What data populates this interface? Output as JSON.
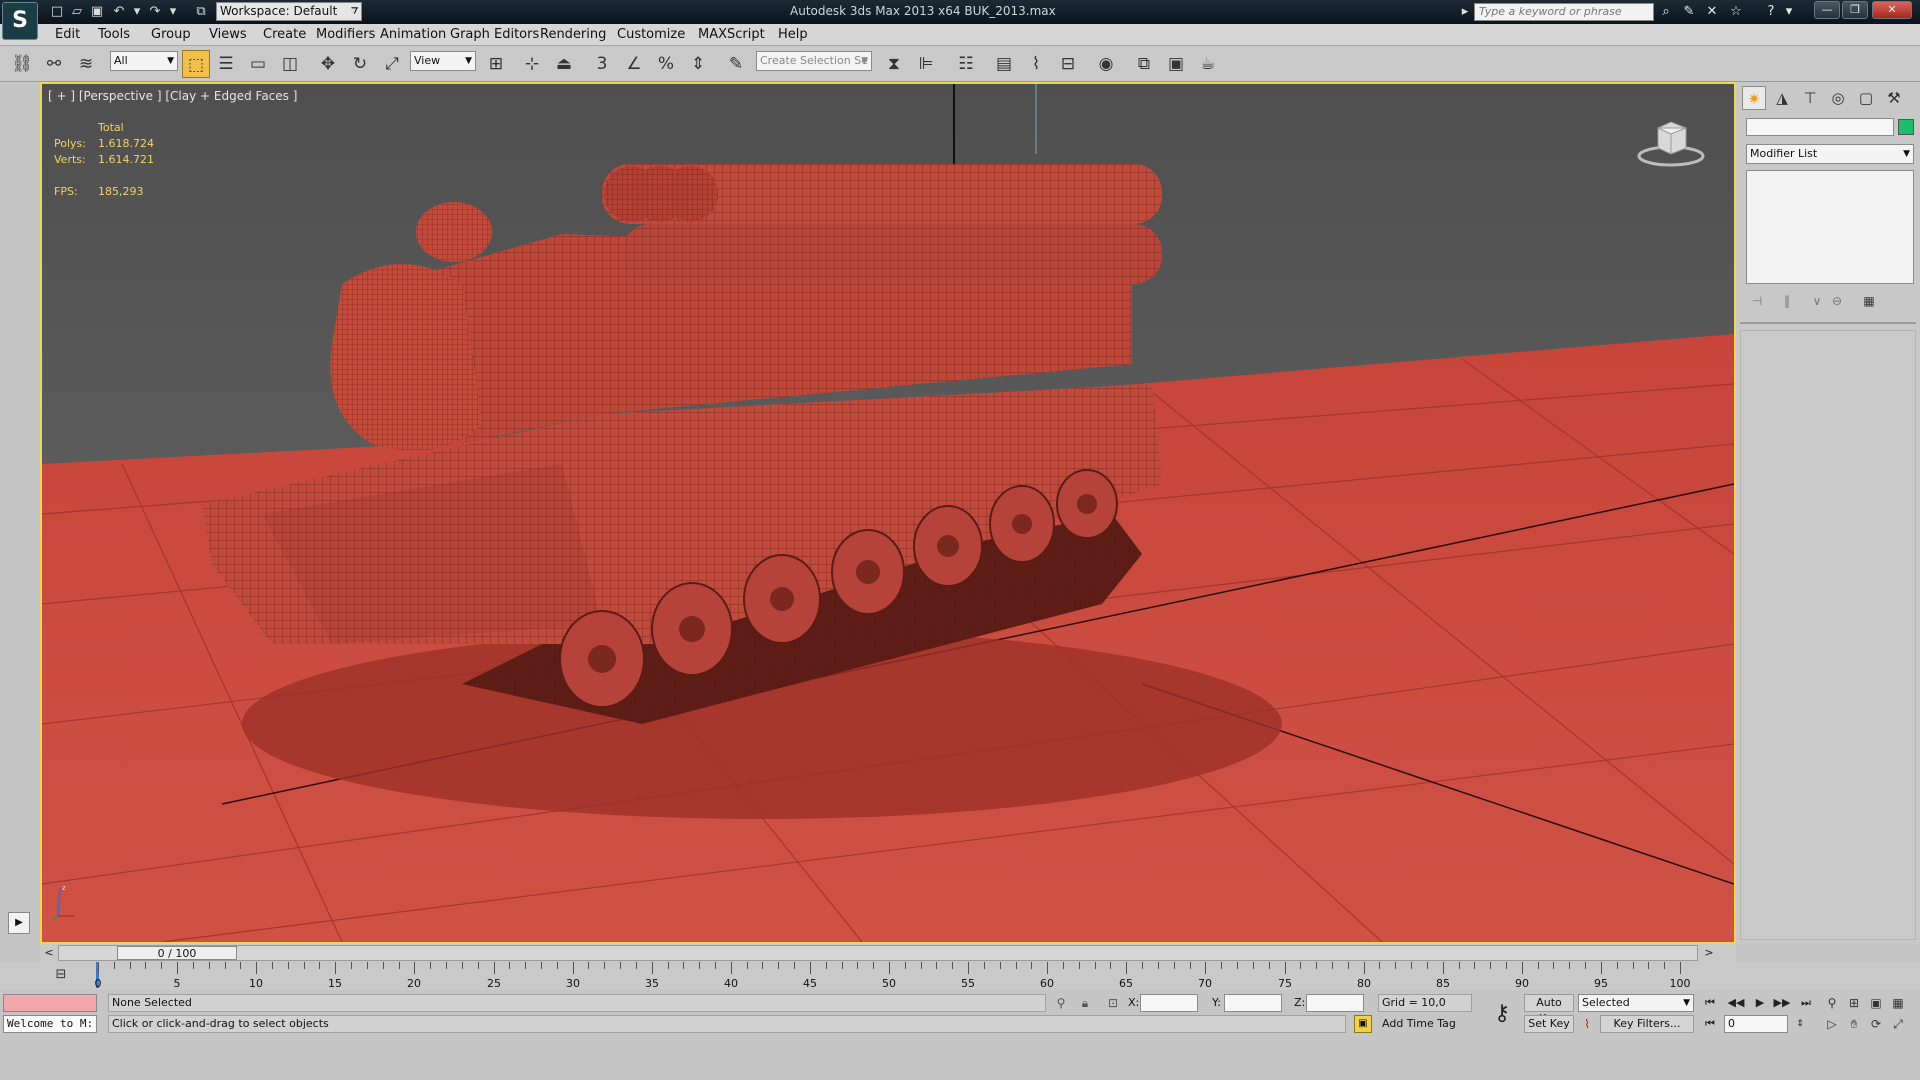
{
  "titlebar": {
    "workspace_label": "Workspace: Default",
    "title": "Autodesk 3ds Max  2013 x64      BUK_2013.max",
    "search_placeholder": "Type a keyword or phrase"
  },
  "menu": [
    "Edit",
    "Tools",
    "Group",
    "Views",
    "Create",
    "Modifiers",
    "Animation",
    "Graph Editors",
    "Rendering",
    "Customize",
    "MAXScript",
    "Help"
  ],
  "toolbar": {
    "selection_filter": "All",
    "ref_coord": "View",
    "named_selection_placeholder": "Create Selection Se"
  },
  "viewport": {
    "label": "[ + ] [Perspective ] [Clay + Edged Faces ]",
    "stats": {
      "header": "Total",
      "polys_label": "Polys:",
      "polys": "1.618.724",
      "verts_label": "Verts:",
      "verts": "1.614.721",
      "fps_label": "FPS:",
      "fps": "185,293"
    },
    "colors": {
      "ground": "#c8483a",
      "model": "#c44a3a",
      "sky": "#5b5b5b",
      "border": "#f1d84a"
    }
  },
  "command_panel": {
    "modifier_list": "Modifier List"
  },
  "timeslider": {
    "position": "0 / 100",
    "prev": "<",
    "next": ">"
  },
  "ruler": {
    "labels": [
      "0",
      "5",
      "10",
      "15",
      "20",
      "25",
      "30",
      "35",
      "40",
      "45",
      "50",
      "55",
      "60",
      "65",
      "70",
      "75",
      "80",
      "85",
      "90",
      "95",
      "100"
    ]
  },
  "status": {
    "welcome": "Welcome to M:",
    "selection": "None Selected",
    "prompt": "Click or click-and-drag to select objects",
    "x_label": "X:",
    "y_label": "Y:",
    "z_label": "Z:",
    "grid": "Grid = 10,0",
    "add_time_tag": "Add Time Tag",
    "auto_key": "Auto Key",
    "set_key": "Set Key",
    "selected_option": "Selected",
    "key_filters": "Key Filters...",
    "current_frame": "0"
  }
}
